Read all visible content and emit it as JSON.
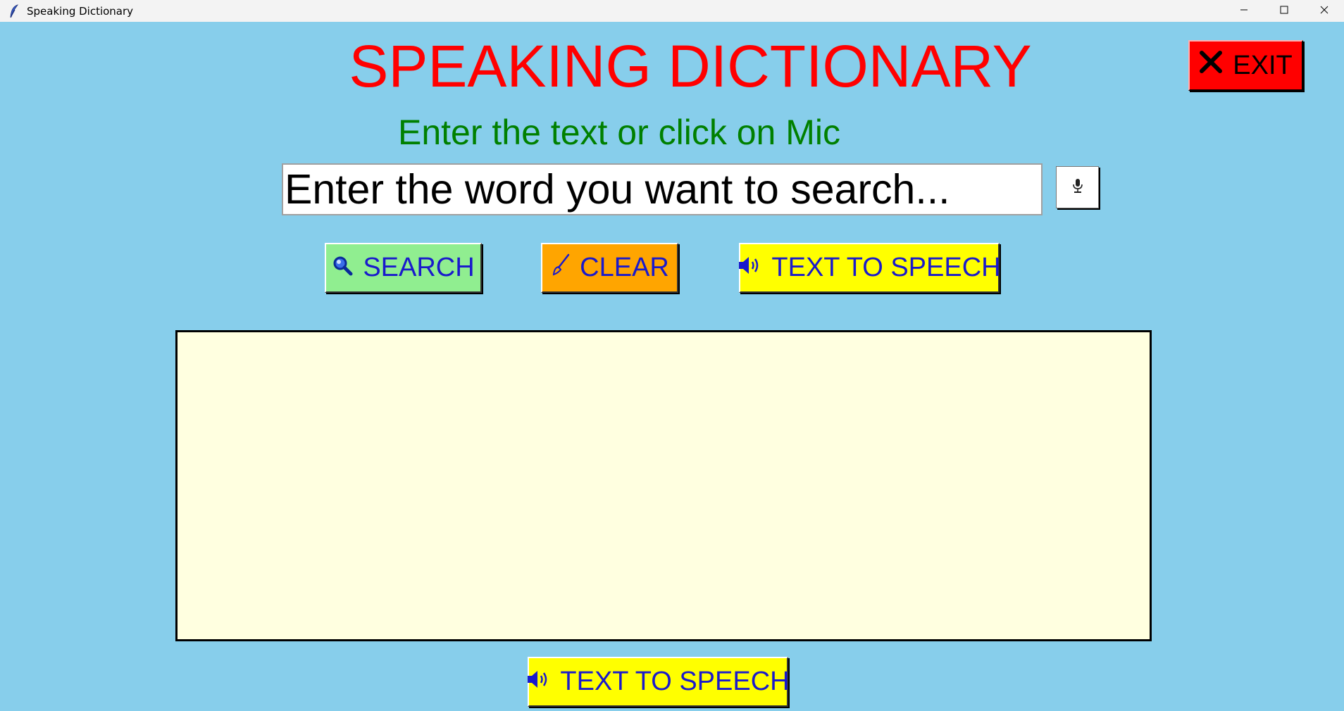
{
  "window": {
    "title": "Speaking Dictionary",
    "app_icon": "feather-icon",
    "controls": [
      "minimize-icon",
      "maximize-icon",
      "close-icon"
    ]
  },
  "header": {
    "title": "SPEAKING DICTIONARY",
    "exit_label": "EXIT",
    "exit_icon": "x-icon"
  },
  "search": {
    "prompt": "Enter the text or click on Mic",
    "placeholder": "Enter the word you want to search...",
    "value": "",
    "mic_icon": "microphone-icon"
  },
  "buttons": {
    "search_label": "SEARCH",
    "clear_label": "CLEAR",
    "tts_label": "TEXT TO SPEECH",
    "tts_bottom_label": "TEXT TO SPEECH"
  },
  "result": {
    "text": ""
  },
  "colors": {
    "background": "#87ceeb",
    "title": "#ff0000",
    "prompt": "#008000",
    "button_text": "#1a1acc",
    "search_btn": "#90ee90",
    "clear_btn": "#ffa500",
    "tts_btn": "#ffff00",
    "exit_btn": "#ff0000",
    "result_bg": "#ffffe0"
  }
}
